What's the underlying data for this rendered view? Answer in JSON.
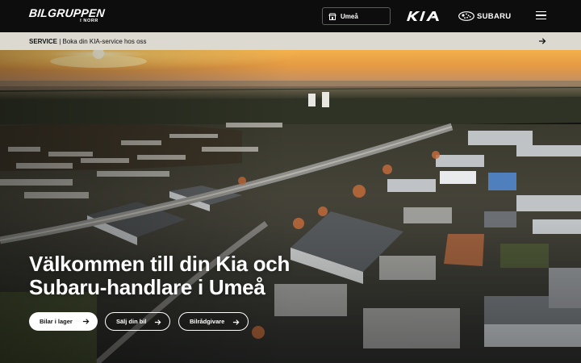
{
  "header": {
    "logo_line1": "BILGRUPPEN",
    "logo_line2": "I NORR",
    "location": "Umeå",
    "brand_subaru": "SUBARU",
    "icons": [
      "store-icon",
      "kia-logo",
      "subaru-logo",
      "hamburger-menu-icon"
    ]
  },
  "service": {
    "bold": "SERVICE",
    "text": " | Boka din KIA-service hos oss",
    "icon": "arrow-right-icon"
  },
  "hero": {
    "title": "Välkommen till din Kia och\nSubaru-handlare i Umeå",
    "buttons": {
      "stock": "Bilar i lager",
      "sell": "Sälj din bil",
      "advice": "Bilrådgivare"
    }
  },
  "colors": {
    "topbar": "#0c0d0c",
    "servicebar": "#dcd9d1",
    "accent_white": "#ffffff"
  }
}
